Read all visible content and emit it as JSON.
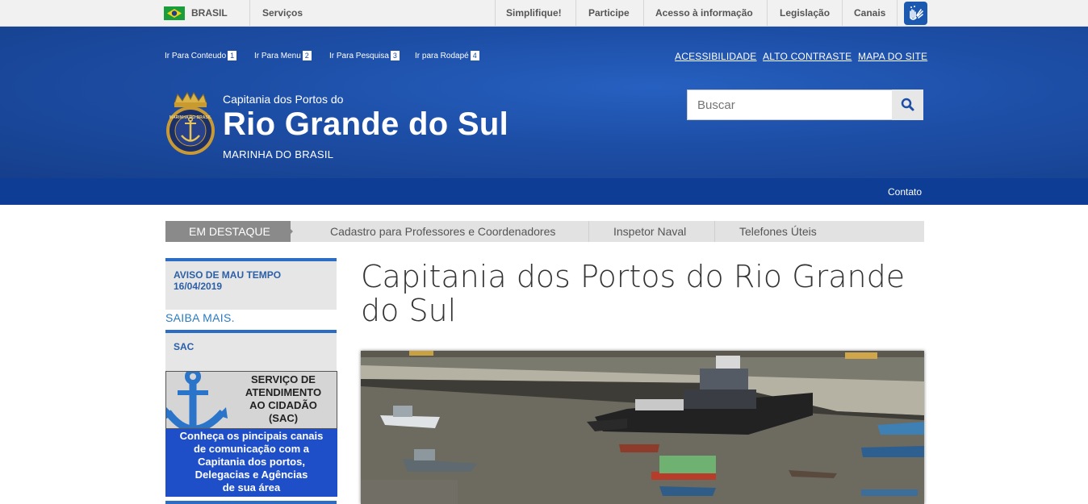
{
  "govbar": {
    "country": "BRASIL",
    "services": "Serviços",
    "links": [
      "Simplifique!",
      "Participe",
      "Acesso à informação",
      "Legislação",
      "Canais"
    ],
    "accessibility_icon": "hands-sign-language-icon",
    "flag_icon": "brazil-flag-icon"
  },
  "header": {
    "skip_links": [
      {
        "label": "Ir Para Conteudo",
        "num": "1"
      },
      {
        "label": "Ir Para Menu",
        "num": "2"
      },
      {
        "label": "Ir Para Pesquisa",
        "num": "3"
      },
      {
        "label": "Ir para Rodapé",
        "num": "4"
      }
    ],
    "top_links": [
      "ACESSIBILIDADE",
      "ALTO CONTRASTE",
      "MAPA DO SITE"
    ],
    "subtitle_top": "Capitania dos Portos do",
    "title": "Rio Grande do Sul",
    "subtitle_bottom": "MARINHA DO BRASIL",
    "search_placeholder": "Buscar",
    "seal_text": "MARINHA DO BRASIL"
  },
  "nav": {
    "contato": "Contato"
  },
  "destaque": {
    "label": "EM DESTAQUE",
    "items": [
      "Cadastro para Professores e Coordenadores",
      "Inspetor Naval",
      "Telefones Úteis"
    ]
  },
  "sidebar": {
    "aviso_title": "AVISO DE MAU TEMPO",
    "aviso_date": "16/04/2019",
    "saiba_mais": "SAIBA MAIS.",
    "sac_title": "SAC",
    "sac_image_lines": [
      "SERVIÇO DE",
      "ATENDIMENTO",
      "AO CIDADÃO",
      "(SAC)"
    ],
    "sac_text_lines": [
      "Conheça os pincipais canais",
      "de comunicação com a",
      "Capitania dos portos,",
      "Delegacias e Agências",
      "de sua área"
    ]
  },
  "main": {
    "page_title": "Capitania dos Portos do Rio Grande do Sul"
  },
  "colors": {
    "header_blue": "#1d4ea6",
    "nav_blue": "#0d3d94",
    "accent_blue": "#2b6cc4",
    "sac_blue": "#1f4fc8"
  }
}
